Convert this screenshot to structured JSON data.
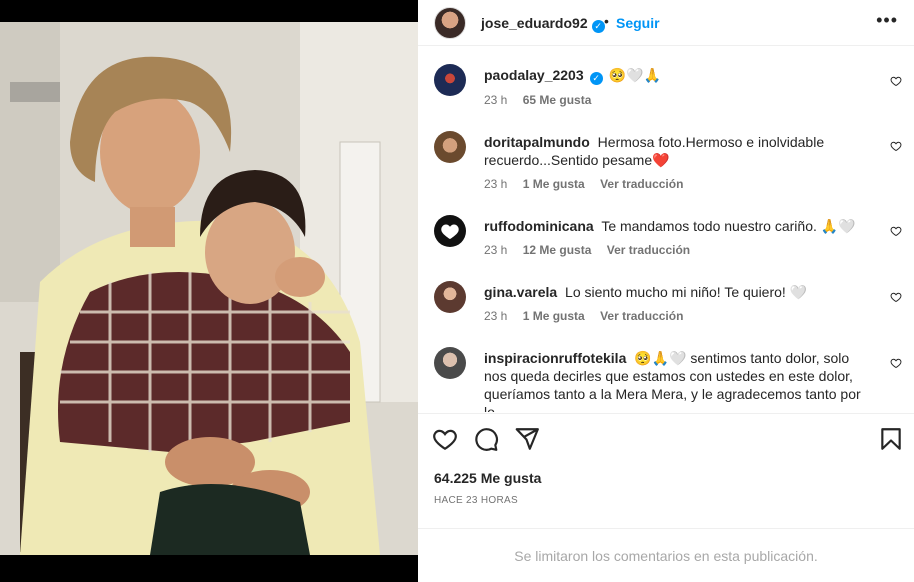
{
  "post": {
    "author": "jose_eduardo92",
    "follow_label": "Seguir",
    "dot": "•",
    "more_label": "•••",
    "verified_mark": "✓"
  },
  "comments": [
    {
      "username": "paodalay_2203",
      "text": "",
      "emoji": "🥺🤍🙏",
      "verified": true,
      "time": "23 h",
      "likes": "65 Me gusta",
      "translate": ""
    },
    {
      "username": "doritapalmundo",
      "text": "Hermosa foto.Hermoso e inolvidable recuerdo...Sentido pesame❤️",
      "time": "23 h",
      "likes": "1 Me gusta",
      "translate": "Ver traducción"
    },
    {
      "username": "ruffodominicana",
      "text": "Te mandamos todo nuestro cariño. 🙏🤍",
      "time": "23 h",
      "likes": "12 Me gusta",
      "translate": "Ver traducción"
    },
    {
      "username": "gina.varela",
      "text": "Lo siento mucho mi niño! Te quiero! 🤍",
      "time": "23 h",
      "likes": "1 Me gusta",
      "translate": "Ver traducción"
    },
    {
      "username": "inspiracionruffotekila",
      "text": "🥺🙏🤍 sentimos tanto dolor, solo nos queda decirles que estamos con ustedes en este dolor, queríamos tanto a la Mera Mera, y le agradecemos tanto por lo",
      "time": "",
      "likes": "",
      "translate": ""
    }
  ],
  "footer": {
    "likes_count": "64.225 Me gusta",
    "posted": "HACE 23 HORAS",
    "comments_closed": "Se limitaron los comentarios en esta publicación."
  },
  "colors": {
    "link_blue": "#0095f6",
    "text": "#262626",
    "muted": "#737373"
  }
}
